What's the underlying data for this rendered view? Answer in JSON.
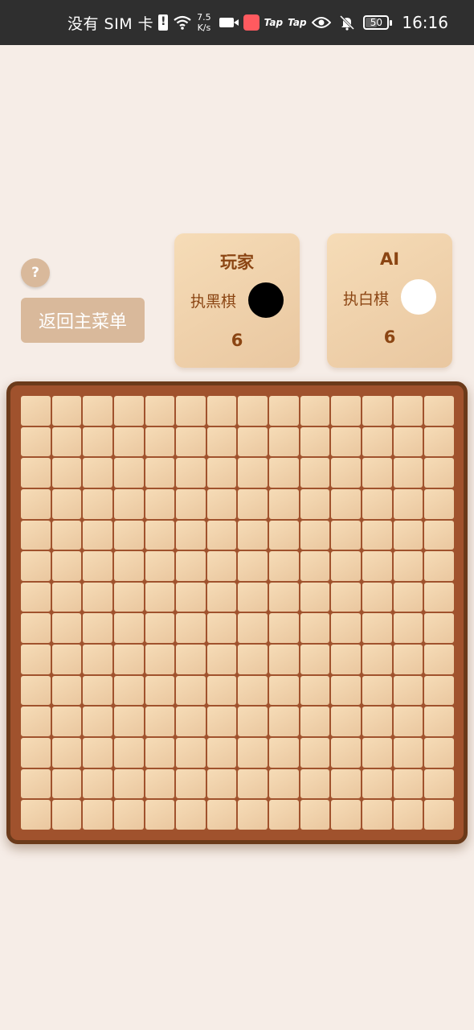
{
  "status_bar": {
    "carrier": "没有 SIM 卡",
    "speed_value": "7.5",
    "speed_unit": "K/s",
    "tap_app_1": "Tap",
    "tap_app_2": "Tap",
    "battery": "50",
    "time": "16:16"
  },
  "help": {
    "label": "?"
  },
  "back_button": {
    "label": "返回主菜单"
  },
  "players": {
    "player": {
      "title": "玩家",
      "color_label": "执黑棋",
      "count": "6",
      "stone_color": "#000000"
    },
    "ai": {
      "title": "AI",
      "color_label": "执白棋",
      "count": "6",
      "stone_color": "#ffffff"
    }
  },
  "board": {
    "rows": 14,
    "cols": 14,
    "frame_color": "#a0522d",
    "cell_color": "#f2d2ac"
  }
}
